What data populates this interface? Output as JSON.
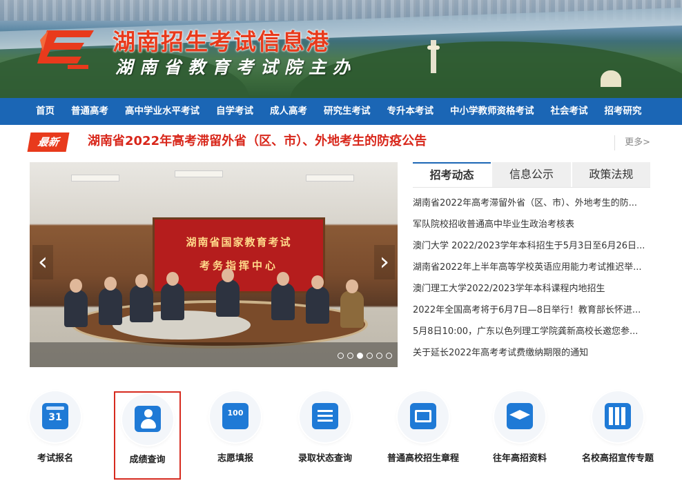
{
  "header": {
    "title": "湖南招生考试信息港",
    "subtitle": "湖南省教育考试院主办"
  },
  "nav": {
    "items": [
      "首页",
      "普通高考",
      "高中学业水平考试",
      "自学考试",
      "成人高考",
      "研究生考试",
      "专升本考试",
      "中小学教师资格考试",
      "社会考试",
      "招考研究"
    ]
  },
  "latest": {
    "badge": "最新",
    "headline": "湖南省2022年高考滞留外省（区、市）、外地考生的防疫公告",
    "more_label": "更多>"
  },
  "slideshow": {
    "screen_text_line1": "湖南省国家教育考试",
    "screen_text_line2": "考务指挥中心",
    "prev_icon": "‹",
    "next_icon": "›",
    "dot_count": 6,
    "active_dot": 2
  },
  "news": {
    "tabs": [
      {
        "label": "招考动态",
        "active": true
      },
      {
        "label": "信息公示",
        "active": false
      },
      {
        "label": "政策法规",
        "active": false
      }
    ],
    "items": [
      "湖南省2022年高考滞留外省（区、市）、外地考生的防...",
      "军队院校招收普通高中毕业生政治考核表",
      "澳门大学 2022/2023学年本科招生于5月3日至6月26日...",
      "湖南省2022年上半年高等学校英语应用能力考试推迟举...",
      "澳门理工大学2022/2023学年本科课程内地招生",
      "2022年全国高考将于6月7日—8日举行！教育部长怀进...",
      "5月8日10:00，广东以色列理工学院龚新高校长邀您参...",
      "关于延长2022年高考考试费缴纳期限的通知"
    ]
  },
  "services": [
    {
      "label": "考试报名",
      "icon": "calendar-icon",
      "glyph": "31"
    },
    {
      "label": "成绩查询",
      "icon": "user-icon",
      "glyph": ""
    },
    {
      "label": "志愿填报",
      "icon": "score-search-icon",
      "glyph": "100"
    },
    {
      "label": "录取状态查询",
      "icon": "document-edit-icon",
      "glyph": ""
    },
    {
      "label": "普通高校招生章程",
      "icon": "mail-icon",
      "glyph": ""
    },
    {
      "label": "往年高招资料",
      "icon": "graduation-cap-icon",
      "glyph": ""
    },
    {
      "label": "名校高招宣传专题",
      "icon": "books-icon",
      "glyph": ""
    }
  ],
  "colors": {
    "nav_bg": "#1b66b5",
    "accent_red": "#e83a1c",
    "headline_red": "#d8261a",
    "icon_blue": "#1f7ad6"
  }
}
